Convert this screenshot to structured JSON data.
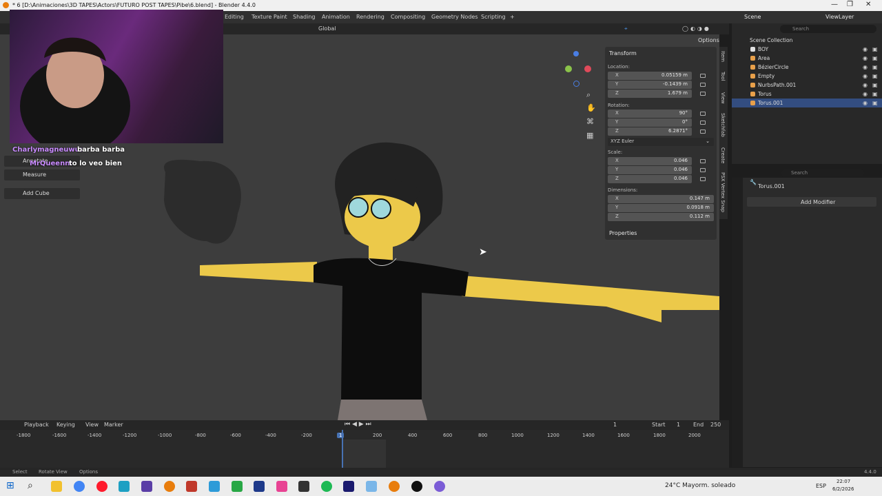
{
  "window": {
    "title": "* 6 [D:\\Animaciones\\3D TAPES\\Actors\\FUTURO POST TAPES\\Pibe\\6.blend] - Blender 4.4.0"
  },
  "workspaces": [
    "Editing",
    "Texture Paint",
    "Shading",
    "Animation",
    "Rendering",
    "Compositing",
    "Geometry Nodes",
    "Scripting",
    "+"
  ],
  "topright": {
    "scene": "Scene",
    "viewlayer": "ViewLayer"
  },
  "viewport_header": {
    "orientation": "Global",
    "options": "Options"
  },
  "chat": [
    {
      "user": "Charlymagneuwu:",
      "msg": "barba barba"
    },
    {
      "user": "MrQueenn:",
      "msg": "to lo veo bien"
    }
  ],
  "tools": [
    "Annotate",
    "Measure",
    "Add Cube"
  ],
  "npanel": {
    "transform": "Transform",
    "location_label": "Location:",
    "location": [
      {
        "axis": "X",
        "value": "0.05159 m"
      },
      {
        "axis": "Y",
        "value": "-0.1439 m"
      },
      {
        "axis": "Z",
        "value": "1.679 m"
      }
    ],
    "rotation_label": "Rotation:",
    "rotation": [
      {
        "axis": "X",
        "value": "90°"
      },
      {
        "axis": "Y",
        "value": "0°"
      },
      {
        "axis": "Z",
        "value": "6.2871°"
      }
    ],
    "rotation_mode": "XYZ Euler",
    "scale_label": "Scale:",
    "scale": [
      {
        "axis": "X",
        "value": "0.046"
      },
      {
        "axis": "Y",
        "value": "0.046"
      },
      {
        "axis": "Z",
        "value": "0.046"
      }
    ],
    "dimensions_label": "Dimensions:",
    "dimensions": [
      {
        "axis": "X",
        "value": "0.147 m"
      },
      {
        "axis": "Y",
        "value": "0.0918 m"
      },
      {
        "axis": "Z",
        "value": "0.112 m"
      }
    ],
    "properties": "Properties",
    "tabs": [
      "Item",
      "Tool",
      "View",
      "Sketchfab",
      "Create",
      "PSX Vertex Snap"
    ]
  },
  "outliner": {
    "search": "Search",
    "collection": "Scene Collection",
    "items": [
      "BOY",
      "Area",
      "BézierCircle",
      "Empty",
      "NurbsPath.001",
      "Torus",
      "Torus.001"
    ]
  },
  "properties": {
    "search": "Search",
    "object": "Torus.001",
    "add_modifier": "Add Modifier"
  },
  "timeline": {
    "menus": [
      "Playback",
      "Keying",
      "View",
      "Marker"
    ],
    "current_frame": "1",
    "start_label": "Start",
    "start": "1",
    "end_label": "End",
    "end": "250",
    "ticks": [
      "-1800",
      "-1600",
      "-1400",
      "-1200",
      "-1000",
      "-800",
      "-600",
      "-400",
      "-200",
      "1",
      "200",
      "400",
      "600",
      "800",
      "1000",
      "1200",
      "1400",
      "1600",
      "1800",
      "2000"
    ]
  },
  "status": {
    "select": "Select",
    "rotate": "Rotate View",
    "options": "Options",
    "version": "4.4.0"
  },
  "taskbar": {
    "weather": "24°C Mayorm. soleado",
    "lang": "ESP",
    "time": "22:07",
    "date": "6/2/2026"
  },
  "colors": {
    "accent": "#4772b3",
    "blender": "#e87d0d",
    "skin": "#ecc94a"
  }
}
